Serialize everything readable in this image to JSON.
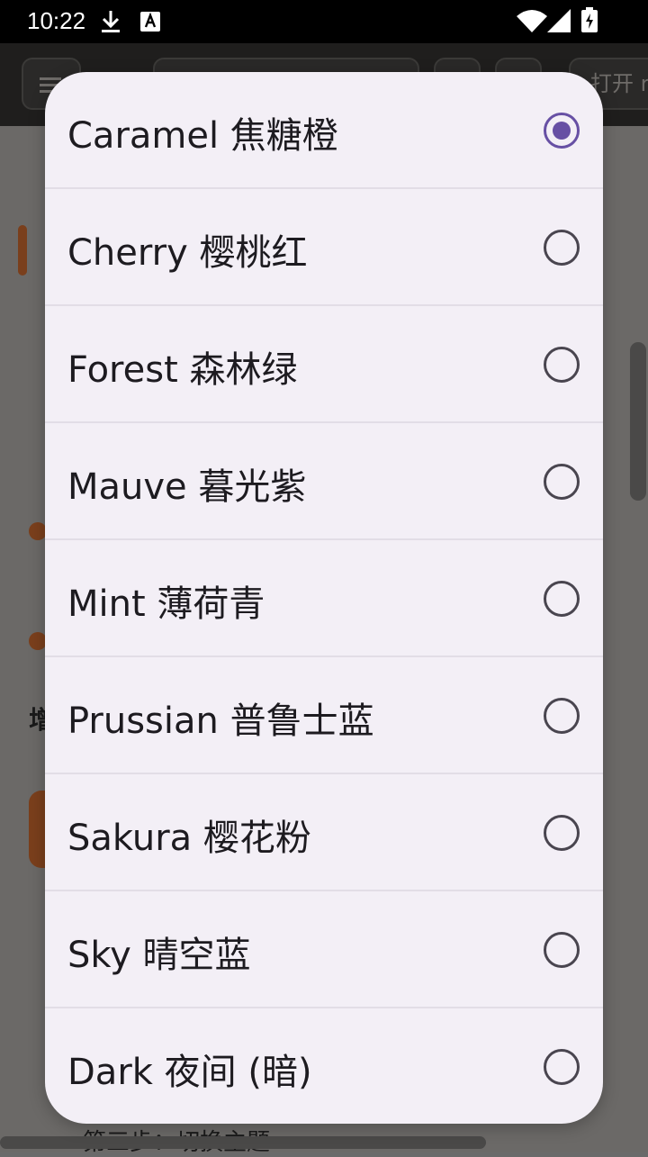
{
  "status_bar": {
    "time": "10:22",
    "icons": [
      "download-icon",
      "text-a-icon",
      "wifi-icon",
      "cellular-signal-icon",
      "battery-charging-icon"
    ]
  },
  "background_app": {
    "toolbar": {
      "open_button_label": "打开 r"
    },
    "partial_heading": "增",
    "partial_bottom_text": "第三步：切换主题"
  },
  "theme_dialog": {
    "options": [
      {
        "label": "Caramel 焦糖橙",
        "selected": true
      },
      {
        "label": "Cherry 樱桃红",
        "selected": false
      },
      {
        "label": "Forest 森林绿",
        "selected": false
      },
      {
        "label": "Mauve 暮光紫",
        "selected": false
      },
      {
        "label": "Mint 薄荷青",
        "selected": false
      },
      {
        "label": "Prussian 普鲁士蓝",
        "selected": false
      },
      {
        "label": "Sakura 樱花粉",
        "selected": false
      },
      {
        "label": "Sky 晴空蓝",
        "selected": false
      },
      {
        "label": "Dark 夜间 (暗)",
        "selected": false
      }
    ]
  },
  "colors": {
    "radio_selected": "#6750a4",
    "radio_unselected": "#49454f",
    "dialog_background": "#f3eff6",
    "scrim": "#6b6967",
    "accent_brand": "#7a3f1c"
  }
}
